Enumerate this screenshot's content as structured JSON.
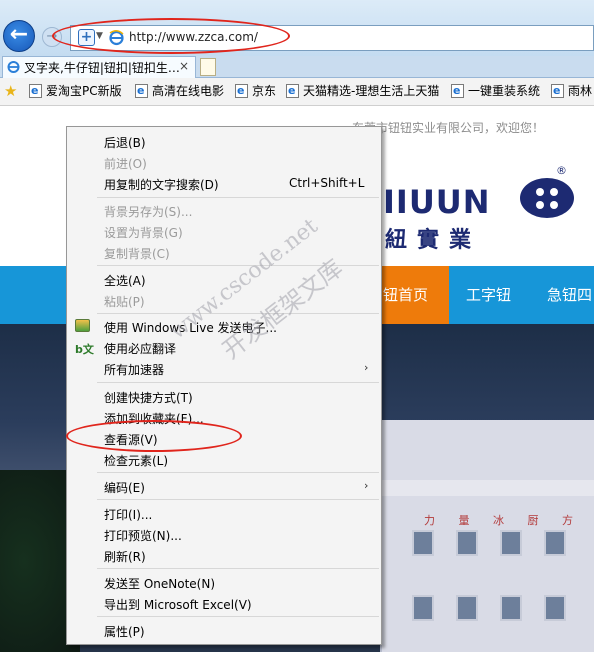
{
  "browser": {
    "back_glyph": "←",
    "forward_glyph": "→",
    "address_url": "http://www.zzca.com/",
    "tab_title": "叉字夹,牛仔钮|钮扣|钮扣生…",
    "tab_close": "×",
    "favorites": [
      {
        "label": "爱淘宝PC新版"
      },
      {
        "label": "高清在线电影"
      },
      {
        "label": "京东"
      },
      {
        "label": "天猫精选-理想生活上天猫"
      },
      {
        "label": "一键重装系统"
      },
      {
        "label": "雨林"
      }
    ]
  },
  "page": {
    "greeting": "东莞市钮钮实业有限公司，欢迎您！",
    "logo_latin": "IIUUN",
    "logo_cn": "紐實業",
    "logo_r": "®",
    "nav": [
      {
        "label": "钮首页"
      },
      {
        "label": "工字钮"
      },
      {
        "label": "急钮四"
      }
    ],
    "building_sign": "力 量 冰 厨 方 向"
  },
  "context_menu": {
    "items": [
      {
        "label": "后退(B)",
        "disabled": false
      },
      {
        "label": "前进(O)",
        "disabled": true
      },
      {
        "label": "用复制的文字搜索(D)",
        "shortcut": "Ctrl+Shift+L",
        "disabled": false
      },
      {
        "label": "背景另存为(S)...",
        "disabled": true
      },
      {
        "label": "设置为背景(G)",
        "disabled": true
      },
      {
        "label": "复制背景(C)",
        "disabled": true
      },
      {
        "label": "全选(A)",
        "disabled": false
      },
      {
        "label": "粘贴(P)",
        "disabled": true
      },
      {
        "label": "使用 Windows Live 发送电子...",
        "disabled": false
      },
      {
        "label": "使用必应翻译",
        "disabled": false
      },
      {
        "label": "所有加速器",
        "submenu": true,
        "disabled": false
      },
      {
        "label": "创建快捷方式(T)",
        "disabled": false
      },
      {
        "label": "添加到收藏夹(F)...",
        "disabled": false
      },
      {
        "label": "查看源(V)",
        "disabled": false
      },
      {
        "label": "检查元素(L)",
        "disabled": false
      },
      {
        "label": "编码(E)",
        "submenu": true,
        "disabled": false
      },
      {
        "label": "打印(I)...",
        "disabled": false
      },
      {
        "label": "打印预览(N)...",
        "disabled": false
      },
      {
        "label": "刷新(R)",
        "disabled": false
      },
      {
        "label": "发送至 OneNote(N)",
        "disabled": false
      },
      {
        "label": "导出到 Microsoft Excel(V)",
        "disabled": false
      },
      {
        "label": "属性(P)",
        "disabled": false
      }
    ],
    "submenu_arrow": "›"
  },
  "watermark": {
    "line1": "www.cscode.net",
    "line2": "开发框架文库"
  },
  "colors": {
    "highlight_ring": "#e0251c",
    "nav_blue": "#1796d8",
    "nav_active": "#ee7b0b",
    "logo_navy": "#1d2a72"
  }
}
